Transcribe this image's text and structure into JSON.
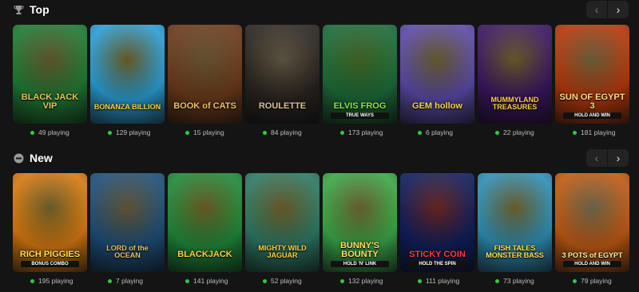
{
  "sections": [
    {
      "title": "Top",
      "icon": "trophy-icon",
      "games": [
        {
          "title": "BLACK JACK VIP",
          "sub": "",
          "count": "49 playing",
          "bg": "#1f7a34",
          "accent": "#e8c54a"
        },
        {
          "title": "BONANZA BILLION",
          "sub": "",
          "count": "129 playing",
          "bg": "#2a9fd6",
          "accent": "#ffd23a"
        },
        {
          "title": "BOOK of CATS",
          "sub": "",
          "count": "15 playing",
          "bg": "#6b3a1a",
          "accent": "#f0c060"
        },
        {
          "title": "ROULETTE",
          "sub": "",
          "count": "84 playing",
          "bg": "#2a2420",
          "accent": "#d9c38a"
        },
        {
          "title": "ELVIS FROG",
          "sub": "TRUE WAYS",
          "count": "173 playing",
          "bg": "#1c6b3a",
          "accent": "#8bea3a"
        },
        {
          "title": "GEM hollow",
          "sub": "",
          "count": "6 playing",
          "bg": "#5b4aa8",
          "accent": "#f2d44a"
        },
        {
          "title": "MUMMYLAND TREASURES",
          "sub": "",
          "count": "22 playing",
          "bg": "#3a1660",
          "accent": "#ffd040"
        },
        {
          "title": "SUN OF EGYPT 3",
          "sub": "HOLD AND WIN",
          "count": "181 playing",
          "bg": "#b5380c",
          "accent": "#ffe07a"
        }
      ]
    },
    {
      "title": "New",
      "icon": "new-icon",
      "games": [
        {
          "title": "RICH PIGGIES",
          "sub": "BONUS COMBO",
          "count": "195 playing",
          "bg": "#d87a10",
          "accent": "#ffe04a"
        },
        {
          "title": "LORD of the OCEAN",
          "sub": "",
          "count": "7 playing",
          "bg": "#1e4f7a",
          "accent": "#e8c060"
        },
        {
          "title": "BLACKJACK",
          "sub": "",
          "count": "141 playing",
          "bg": "#1f8a3a",
          "accent": "#ffd23a"
        },
        {
          "title": "MIGHTY WILD JAGUAR",
          "sub": "",
          "count": "52 playing",
          "bg": "#2c7a66",
          "accent": "#ffd040"
        },
        {
          "title": "BUNNY'S BOUNTY",
          "sub": "HOLD 'N' LINK",
          "count": "132 playing",
          "bg": "#3aa848",
          "accent": "#ffe05a"
        },
        {
          "title": "STICKY COIN",
          "sub": "HOLD THE SPIN",
          "count": "111 playing",
          "bg": "#0e1f5c",
          "accent": "#ff3a30"
        },
        {
          "title": "FISH TALES MONSTER BASS",
          "sub": "",
          "count": "73 playing",
          "bg": "#2f8fb8",
          "accent": "#ffe04a"
        },
        {
          "title": "3 POTS of EGYPT",
          "sub": "HOLD AND WIN",
          "count": "79 playing",
          "bg": "#c25a12",
          "accent": "#fff2a8"
        }
      ]
    }
  ],
  "nav": {
    "prev": "‹",
    "next": "›"
  },
  "colors": {
    "background": "#141414",
    "online_dot": "#2ecc40",
    "count_text": "#bdbdbd"
  }
}
